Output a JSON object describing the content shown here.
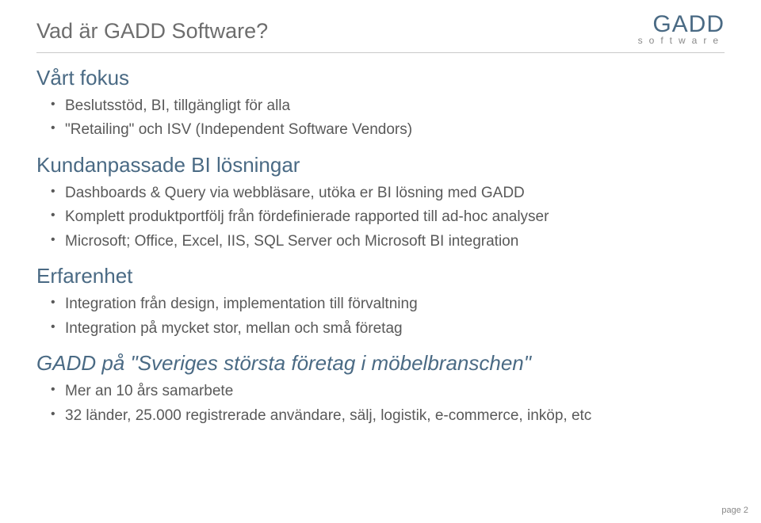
{
  "header": {
    "title": "Vad är GADD Software?",
    "logo_main": "GADD",
    "logo_sub": "software"
  },
  "sections": [
    {
      "heading": "Vårt fokus",
      "bullets": [
        "Beslutsstöd, BI, tillgängligt för alla",
        "\"Retailing\" och ISV (Independent Software Vendors)"
      ]
    },
    {
      "heading": "Kundanpassade BI lösningar",
      "bullets": [
        "Dashboards & Query via webbläsare, utöka er BI lösning med GADD",
        "Komplett produktportfölj från fördefinierade rapported till ad-hoc analyser",
        "Microsoft; Office, Excel, IIS, SQL Server och Microsoft BI integration"
      ]
    },
    {
      "heading": "Erfarenhet",
      "bullets": [
        "Integration från design, implementation till förvaltning",
        "Integration på mycket stor, mellan och små företag"
      ]
    }
  ],
  "subheading": "GADD på \"Sveriges största företag i möbelbranschen\"",
  "sub_bullets": [
    "Mer an 10 års samarbete",
    "32 länder, 25.000 registrerade användare, sälj, logistik, e-commerce, inköp, etc"
  ],
  "footer": "page 2"
}
